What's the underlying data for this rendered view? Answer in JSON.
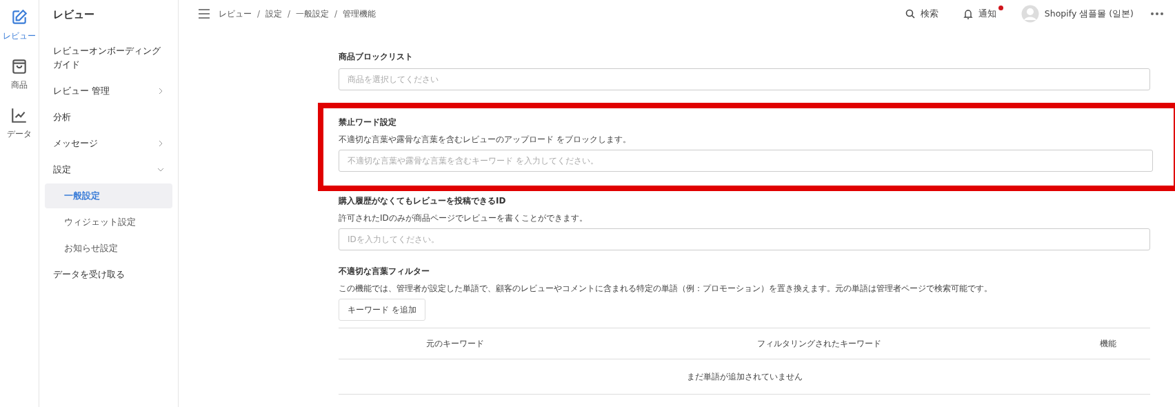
{
  "rail": [
    {
      "label": "レビュー",
      "selected": true
    },
    {
      "label": "商品",
      "selected": false
    },
    {
      "label": "データ",
      "selected": false
    }
  ],
  "sidebar": {
    "title": "レビュー",
    "items": [
      {
        "label": "レビューオンボーディングガイド",
        "selected": false
      },
      {
        "label": "レビュー 管理",
        "expanded": false,
        "selected": false
      },
      {
        "label": "分析",
        "selected": false
      },
      {
        "label": "メッセージ",
        "expanded": false,
        "selected": false
      },
      {
        "label": "設定",
        "expanded": true,
        "selected": false,
        "children": [
          {
            "label": "一般設定",
            "selected": true
          },
          {
            "label": "ウィジェット設定",
            "selected": false
          },
          {
            "label": "お知らせ設定",
            "selected": false
          }
        ]
      },
      {
        "label": "データを受け取る",
        "selected": false
      }
    ]
  },
  "breadcrumb": {
    "items": [
      "レビュー",
      "設定",
      "一般設定",
      "管理機能"
    ],
    "separator": "/"
  },
  "header": {
    "search": "検索",
    "notifications": "通知",
    "has_unread": true,
    "account": "Shopify 샘플몰 (일본)"
  },
  "sections": [
    {
      "kind": "input",
      "title": "商品ブロックリスト",
      "placeholder": "商品を選択してください",
      "highlighted": false
    },
    {
      "kind": "input",
      "title": "禁止ワード設定",
      "description": "不適切な言葉や露骨な言葉を含むレビューのアップロード をブロックします。",
      "placeholder": "不適切な言葉や露骨な言葉を含むキーワード を入力してください。",
      "highlighted": true
    },
    {
      "kind": "input",
      "title": "購入履歴がなくてもレビューを投稿できるID",
      "description": "許可されたIDのみが商品ページでレビューを書くことができます。",
      "placeholder": "IDを入力してください。",
      "highlighted": false
    },
    {
      "kind": "table",
      "title": "不適切な言葉フィルター",
      "description": "この機能では、管理者が設定した単語で、顧客のレビューやコメントに含まれる特定の単語（例：プロモーション）を置き換えます。元の単語は管理者ページで検索可能です。",
      "button": "キーワード を追加",
      "columns": [
        "元のキーワード",
        "フィルタリングされたキーワード",
        "機能"
      ],
      "empty": "まだ単語が追加されていません",
      "highlighted": false
    }
  ]
}
